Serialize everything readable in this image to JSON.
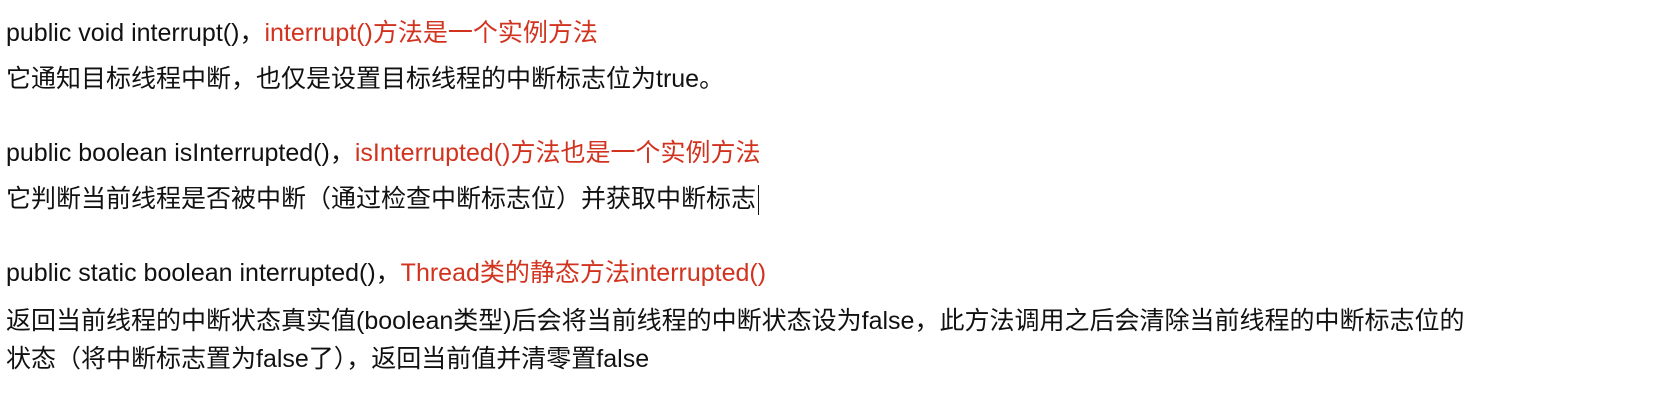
{
  "sections": [
    {
      "signature": "public void interrupt()",
      "separator": "，",
      "note": "interrupt()方法是一个实例方法",
      "desc": "它通知目标线程中断，也仅是设置目标线程的中断标志位为true。"
    },
    {
      "signature": "public boolean isInterrupted()",
      "separator": "，",
      "note": "isInterrupted()方法也是一个实例方法",
      "desc": "它判断当前线程是否被中断（通过检查中断标志位）并获取中断标志"
    },
    {
      "signature": "public static boolean interrupted()",
      "separator": "，",
      "note": "Thread类的静态方法interrupted()",
      "desc_line1": "返回当前线程的中断状态真实值(boolean类型)后会将当前线程的中断状态设为false，此方法调用之后会清除当前线程的中断标志位的",
      "desc_line2": "状态（将中断标志置为false了），返回当前值并清零置false"
    }
  ],
  "colors": {
    "text": "#111111",
    "note": "#d2331f",
    "background": "#ffffff"
  }
}
